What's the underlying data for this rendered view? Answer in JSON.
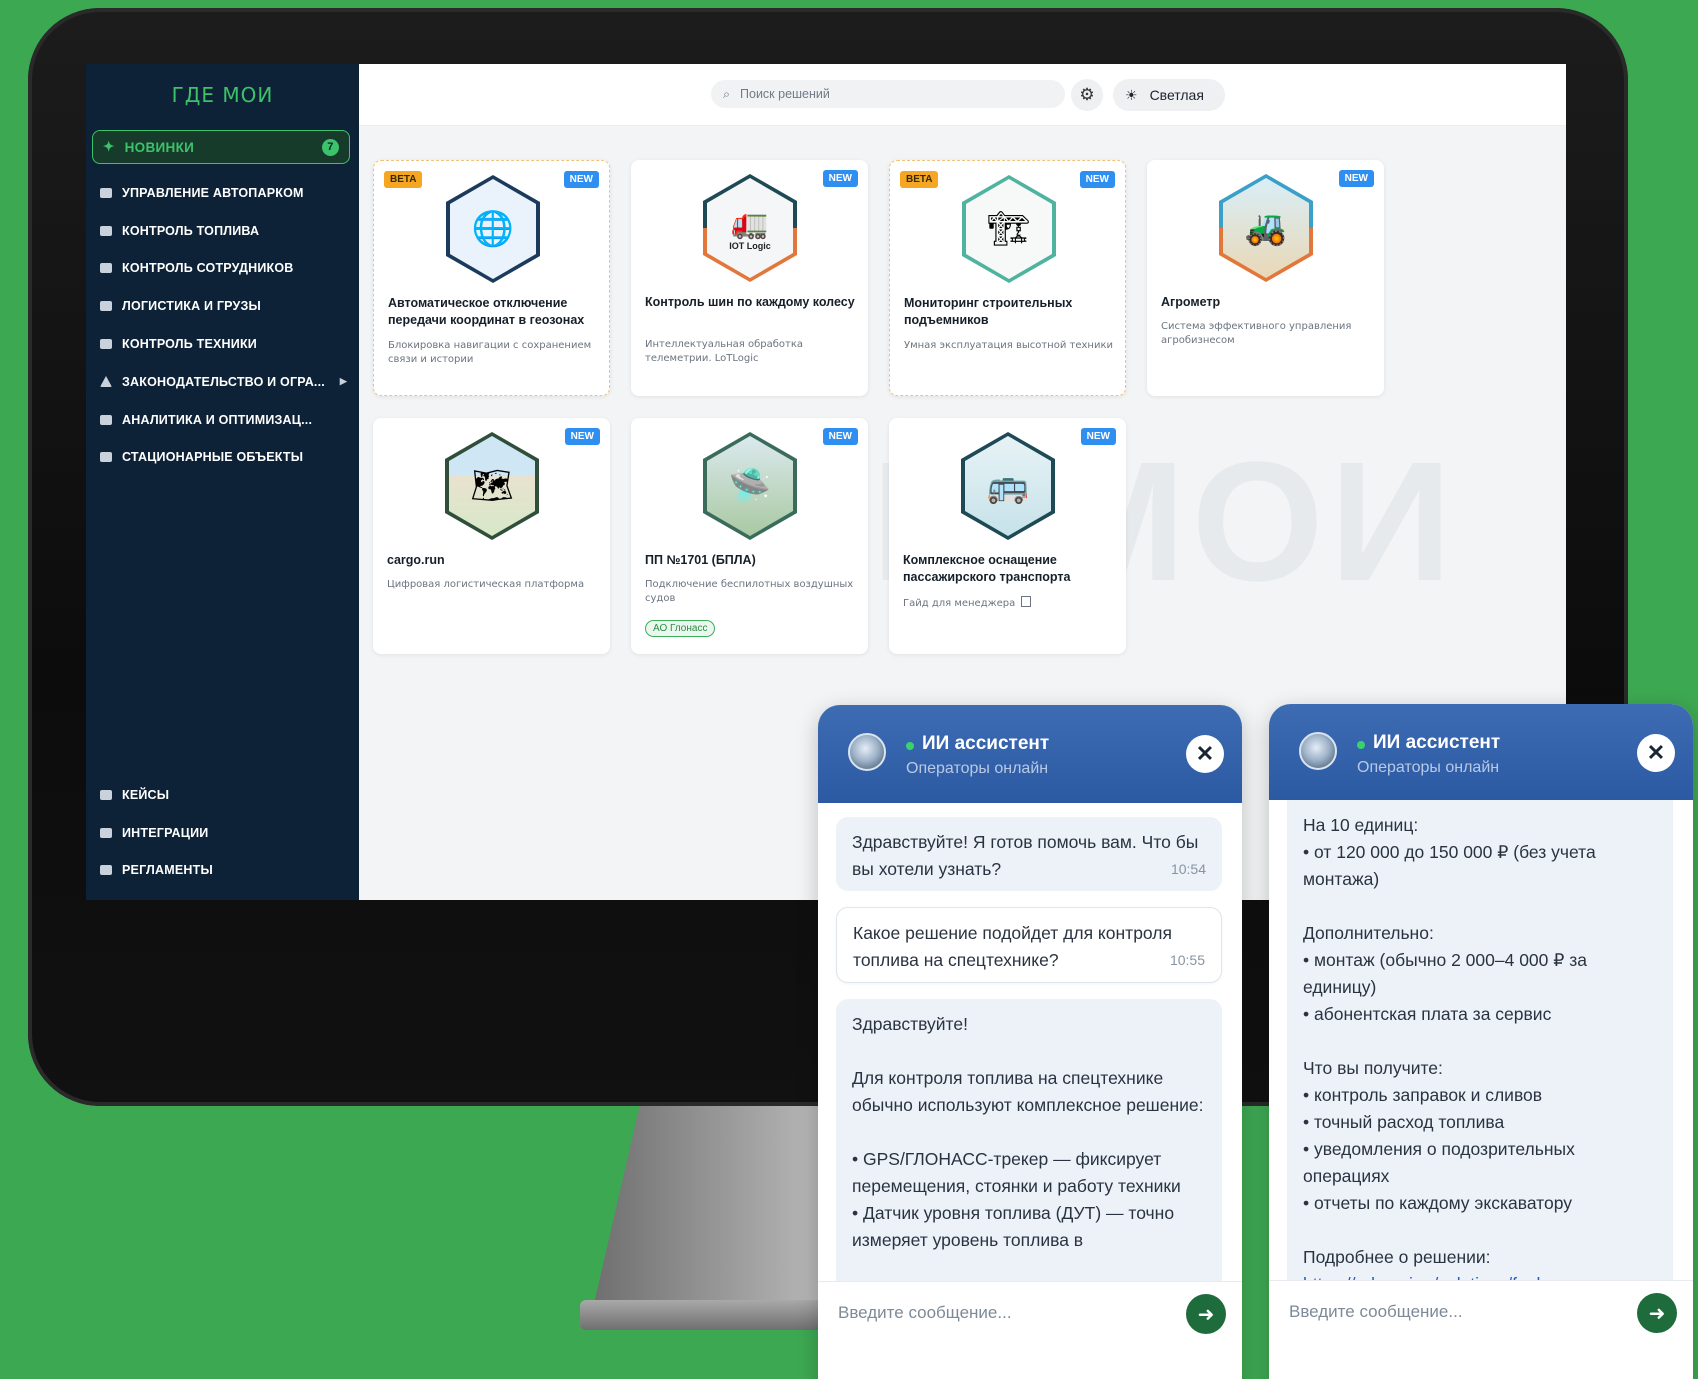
{
  "sidebar": {
    "logo": "ГДЕ МОИ",
    "new": {
      "label": "НОВИНКИ",
      "count": "7"
    },
    "items": [
      {
        "label": "УПРАВЛЕНИЕ АВТОПАРКОМ"
      },
      {
        "label": "КОНТРОЛЬ ТОПЛИВА"
      },
      {
        "label": "КОНТРОЛЬ СОТРУДНИКОВ"
      },
      {
        "label": "ЛОГИСТИКА И ГРУЗЫ"
      },
      {
        "label": "КОНТРОЛЬ ТЕХНИКИ"
      },
      {
        "label": "ЗАКОНОДАТЕЛЬСТВО И ОГРА..."
      },
      {
        "label": "АНАЛИТИКА И ОПТИМИЗАЦ..."
      },
      {
        "label": "СТАЦИОНАРНЫЕ ОБЪЕКТЫ"
      }
    ],
    "bottom_items": [
      {
        "label": "КЕЙСЫ"
      },
      {
        "label": "ИНТЕГРАЦИИ"
      },
      {
        "label": "РЕГЛАМЕНТЫ"
      }
    ]
  },
  "topbar": {
    "search_placeholder": "Поиск решений",
    "theme_label": "Светлая"
  },
  "cards": [
    {
      "title": "Автоматическое отключение передачи координат в геозонах",
      "desc": "Блокировка навигации с сохранением связи и истории",
      "beta": "BETA",
      "new": "NEW",
      "icon": "globe-icon"
    },
    {
      "title": "Контроль шин по каждому колесу",
      "desc": "Интеллектуальная обработка телеметрии. LoTLogic",
      "new": "NEW",
      "icon": "truck-icon",
      "icon_caption": "IOT Logic"
    },
    {
      "title": "Мониторинг строительных подъемников",
      "desc": "Умная эксплуатация высотной техники",
      "beta": "BETA",
      "new": "NEW",
      "icon": "building-icon"
    },
    {
      "title": "Агрометр",
      "desc": "Система эффективного управления агробизнесом",
      "new": "NEW",
      "icon": "harvester-icon"
    },
    {
      "title": "cargo.run",
      "desc": "Цифровая логистическая платформа",
      "new": "NEW",
      "icon": "map-route-icon"
    },
    {
      "title": "ПП №1701 (БПЛА)",
      "desc": "Подключение беспилотных воздушных судов",
      "new": "NEW",
      "tag": "АО Глонасс",
      "icon": "drone-icon"
    },
    {
      "title": "Комплексное оснащение пассажирского транспорта",
      "desc": "Гайд для менеджера",
      "new": "NEW",
      "icon": "bus-icon"
    }
  ],
  "chat_left": {
    "title": "ИИ ассистент",
    "subtitle": "Операторы онлайн",
    "messages": [
      {
        "role": "bot",
        "text": "Здравствуйте! Я готов помочь вам. Что бы вы хотели узнать?",
        "time": "10:54"
      },
      {
        "role": "user",
        "text": "Какое решение подойдет для контроля топлива на спецтехнике?",
        "time": "10:55"
      },
      {
        "role": "bot",
        "text": "Здравствуйте!\n\nДля контроля топлива на спецтехнике обычно используют комплексное решение:\n\n• GPS/ГЛОНАСС-трекер — фиксирует перемещения, стоянки и работу техники\n• Датчик уровня топлива (ДУТ) — точно измеряет уровень топлива в"
      }
    ],
    "input_placeholder": "Введите сообщение..."
  },
  "chat_right": {
    "title": "ИИ ассистент",
    "subtitle": "Операторы онлайн",
    "text": "На 10 единиц:\n• от 120 000 до 150 000 ₽ (без учета монтажа)\n\nДополнительно:\n• монтаж (обычно 2 000–4 000 ₽ за единицу)\n• абонентская плата за сервис\n\nЧто вы получите:\n• контроль заправок и сливов\n• точный расход топлива\n• уведомления о подозрительных операциях\n• отчеты по каждому экскаватору\n\nПодробнее о решении:",
    "link": "https://gdemoi.ru/solutions/fuel-",
    "input_placeholder": "Введите сообщение..."
  },
  "colors": {
    "background": "#3da852",
    "sidebar": "#0e2237",
    "accent_green": "#3cc26a",
    "badge_new": "#2f8ff1",
    "badge_beta": "#f5a623",
    "chat_header": "#2b5aa3"
  }
}
